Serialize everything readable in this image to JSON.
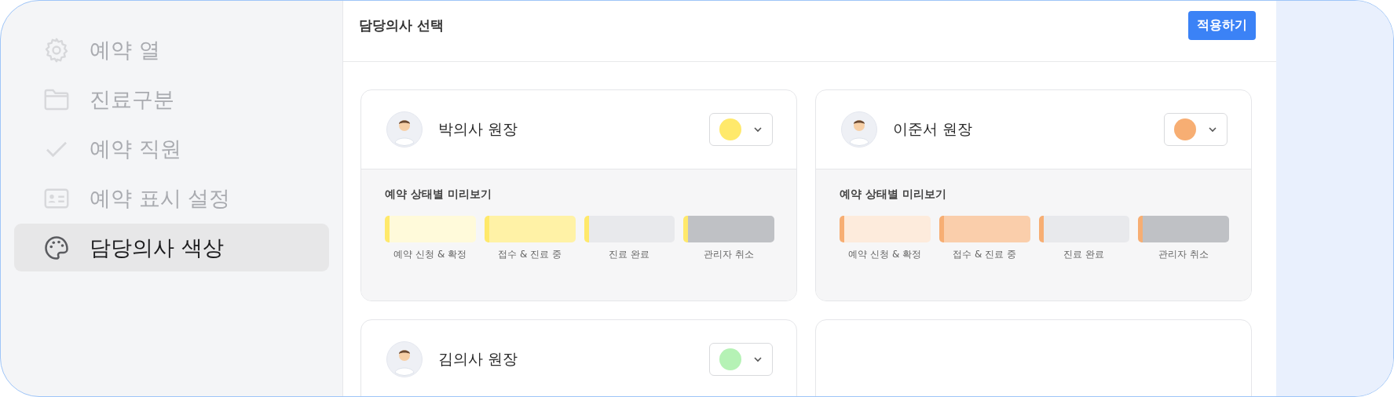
{
  "sidebar": {
    "items": [
      {
        "kind": "gear",
        "label": "예약 열",
        "selected": false
      },
      {
        "kind": "folder",
        "label": "진료구분",
        "selected": false
      },
      {
        "kind": "check",
        "label": "예약 직원",
        "selected": false
      },
      {
        "kind": "card",
        "label": "예약 표시 설정",
        "selected": false
      },
      {
        "kind": "palette",
        "label": "담당의사 색상",
        "selected": true
      }
    ]
  },
  "header": {
    "title": "담당의사 선택",
    "apply_button": "적용하기"
  },
  "doctors": [
    {
      "name": "박의사 원장",
      "color": "#ffe96b",
      "preview_title": "예약 상태별 미리보기",
      "statuses": [
        {
          "kind": "requested",
          "label": "예약 신청 & 확정"
        },
        {
          "kind": "in_progress",
          "label": "접수 & 진료 중"
        },
        {
          "kind": "done",
          "label": "진료 완료"
        },
        {
          "kind": "cancelled",
          "label": "관리자 취소"
        }
      ]
    },
    {
      "name": "이준서 원장",
      "color": "#f7ae73",
      "preview_title": "예약 상태별 미리보기",
      "statuses": [
        {
          "kind": "requested",
          "label": "예약 신청 & 확정"
        },
        {
          "kind": "in_progress",
          "label": "접수 & 진료 중"
        },
        {
          "kind": "done",
          "label": "진료 완료"
        },
        {
          "kind": "cancelled",
          "label": "관리자 취소"
        }
      ]
    },
    {
      "name": "김의사 원장",
      "color": "#b5f2b5"
    }
  ]
}
